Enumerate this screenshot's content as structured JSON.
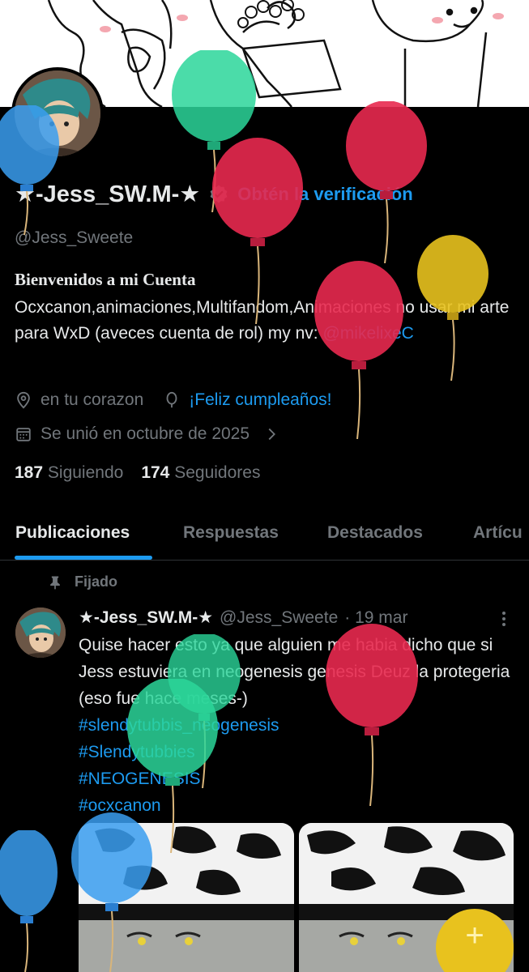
{
  "profile": {
    "display_name": "★-Jess_SW.M-★",
    "verify_cta": "Obtén la verificación",
    "handle": "@Jess_Sweete",
    "bio_title": "Bienvenidos a mi Cuenta",
    "bio_text": "Ocxcanon,animaciones,Multifandom,Animaciones no usar mi arte para WxD (aveces cuenta de rol) my nv: ",
    "bio_mention": "@mikelixeC",
    "location": "en tu corazon",
    "birthday": "¡Feliz cumpleaños!",
    "joined": "Se unió en octubre de 2025",
    "following_count": "187",
    "following_label": "Siguiendo",
    "followers_count": "174",
    "followers_label": "Seguidores"
  },
  "tabs": [
    {
      "label": "Publicaciones"
    },
    {
      "label": "Respuestas"
    },
    {
      "label": "Destacados"
    },
    {
      "label": "Artícu"
    }
  ],
  "post": {
    "pinned_label": "Fijado",
    "author_name": "★-Jess_SW.M-★",
    "author_handle": "@Jess_Sweete",
    "date": "· 19 mar",
    "text": "Quise hacer esto ya que alguien me habia dicho que si Jess estuviera en neogenesis genesis Deuz la protegeria (eso fue hace meses-)",
    "hashtags": [
      "#slendytubbis_neogenesis",
      "#Slendytubbies",
      "#NEOGENESIS",
      "#ocxcanon"
    ]
  },
  "fab": {
    "label": "+"
  },
  "colors": {
    "accent": "#1d9bf0",
    "muted": "#71767b",
    "text": "#e7e9ea",
    "balloon_red": "#e8294f",
    "balloon_green": "#2bd69a",
    "balloon_blue": "#3a9ef0",
    "balloon_yellow": "#e8c21e"
  }
}
